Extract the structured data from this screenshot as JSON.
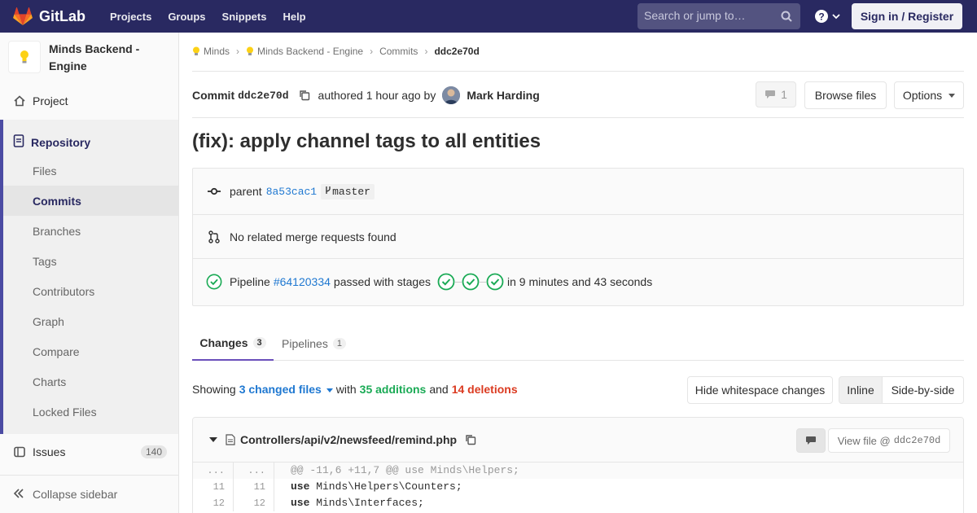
{
  "navbar": {
    "brand": "GitLab",
    "links": [
      "Projects",
      "Groups",
      "Snippets",
      "Help"
    ],
    "search_placeholder": "Search or jump to…",
    "signin": "Sign in / Register"
  },
  "sidebar": {
    "project_name": "Minds Backend - Engine",
    "project": "Project",
    "repository": "Repository",
    "repo_items": [
      "Files",
      "Commits",
      "Branches",
      "Tags",
      "Contributors",
      "Graph",
      "Compare",
      "Charts",
      "Locked Files"
    ],
    "issues": "Issues",
    "issues_count": "140",
    "collapse": "Collapse sidebar"
  },
  "breadcrumb": [
    "Minds",
    "Minds Backend - Engine",
    "Commits",
    "ddc2e70d"
  ],
  "commit": {
    "label": "Commit",
    "sha": "ddc2e70d",
    "authored": "authored 1 hour ago by",
    "author": "Mark Harding",
    "comments": "1",
    "browse": "Browse files",
    "options": "Options",
    "title": "(fix): apply channel tags to all entities"
  },
  "info": {
    "parent_label": "parent",
    "parent_sha": "8a53cac1",
    "branch": "master",
    "merge_requests": "No related merge requests found",
    "pipeline_label": "Pipeline",
    "pipeline_id": "#64120334",
    "pipeline_status": "passed with stages",
    "pipeline_duration": "in 9 minutes and 43 seconds"
  },
  "tabs": [
    {
      "label": "Changes",
      "count": "3"
    },
    {
      "label": "Pipelines",
      "count": "1"
    }
  ],
  "stats": {
    "showing": "Showing",
    "changed": "3 changed files",
    "with": "with",
    "additions": "35 additions",
    "and": "and",
    "deletions": "14 deletions",
    "hide_ws": "Hide whitespace changes",
    "inline": "Inline",
    "side": "Side-by-side"
  },
  "file": {
    "path": "Controllers/api/v2/newsfeed/remind.php",
    "view": "View file @",
    "view_sha": "ddc2e70d",
    "lines": [
      {
        "old": "...",
        "new": "...",
        "code": "@@ -11,6 +11,7 @@ use Minds\\Helpers;"
      },
      {
        "old": "11",
        "new": "11",
        "kw": "use",
        "code": " Minds\\Helpers\\Counters;"
      },
      {
        "old": "12",
        "new": "12",
        "kw": "use",
        "code": " Minds\\Interfaces;"
      }
    ]
  },
  "colors": {
    "navbar": "#292961",
    "accent": "#6b4fbb",
    "link": "#1f78d1",
    "success": "#1aaa55",
    "danger": "#db3b21"
  }
}
